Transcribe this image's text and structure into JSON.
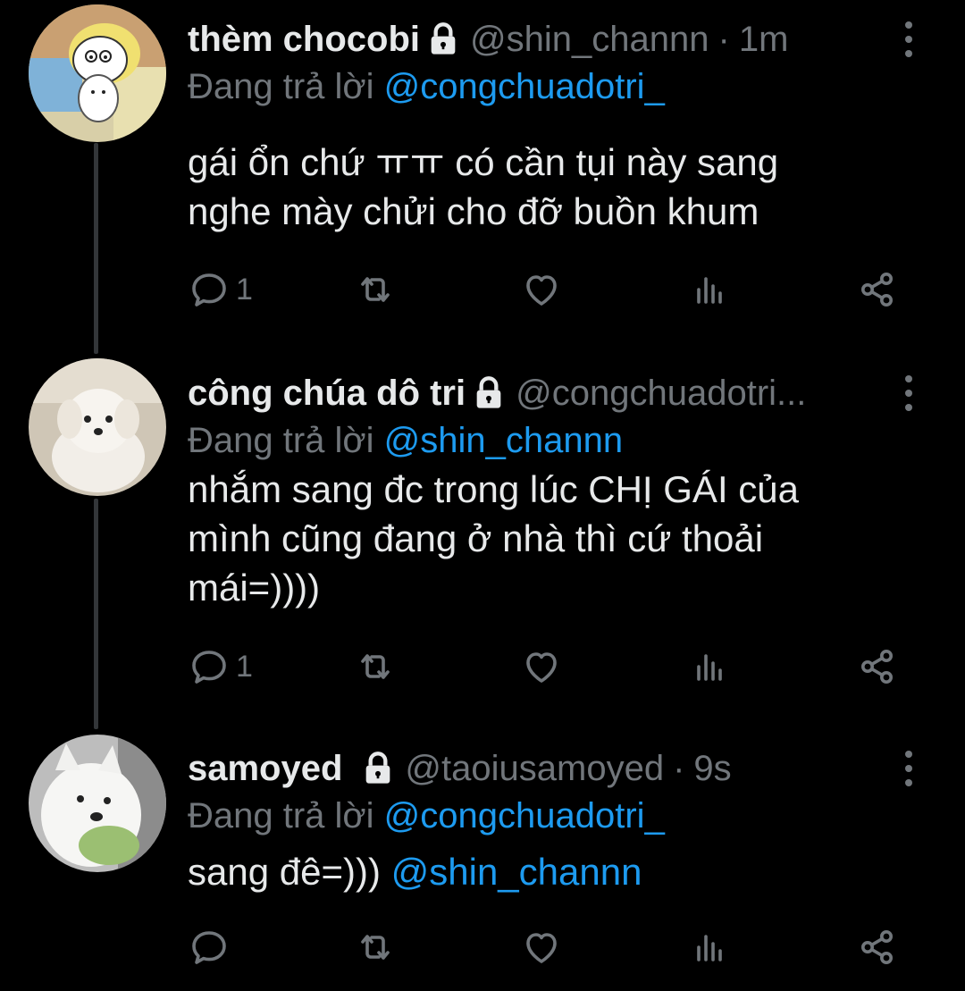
{
  "colors": {
    "background": "#000000",
    "text_primary": "#e7e9ea",
    "text_secondary": "#71767b",
    "link": "#1d9bf0",
    "thread_line": "#333639"
  },
  "tweets": [
    {
      "display_name": "thèm chocobi",
      "handle": "@shin_channn",
      "separator": "·",
      "time": "1m",
      "reply_prefix": "Đang trả lời",
      "reply_to": "@congchuadotri_",
      "body": [
        "gái ổn chứ ㅠㅠ có cần tụi này sang",
        "nghe mày chửi cho đỡ buồn khum"
      ],
      "reply_count": "1",
      "icons": [
        "lock-icon",
        "more-icon",
        "reply-icon",
        "retweet-icon",
        "like-icon",
        "views-icon",
        "share-icon"
      ]
    },
    {
      "display_name": "công chúa dô tri",
      "handle": "@congchuadotri...",
      "reply_prefix": "Đang trả lời",
      "reply_to": "@shin_channn",
      "body": [
        "nhắm sang đc trong lúc CHỊ GÁI của",
        "mình cũng đang ở nhà thì cứ thoải",
        "mái=))))"
      ],
      "reply_count": "1",
      "icons": [
        "lock-icon",
        "more-icon",
        "reply-icon",
        "retweet-icon",
        "like-icon",
        "views-icon",
        "share-icon"
      ]
    },
    {
      "display_name": "samoyed",
      "handle": "@taoiusamoyed",
      "separator": "·",
      "time": "9s",
      "reply_prefix": "Đang trả lời",
      "reply_to": "@congchuadotri_",
      "body_text": "sang đê=)))",
      "body_mention": "@shin_channn",
      "reply_count": "",
      "icons": [
        "lock-icon",
        "more-icon",
        "reply-icon",
        "retweet-icon",
        "like-icon",
        "views-icon",
        "share-icon"
      ]
    }
  ]
}
